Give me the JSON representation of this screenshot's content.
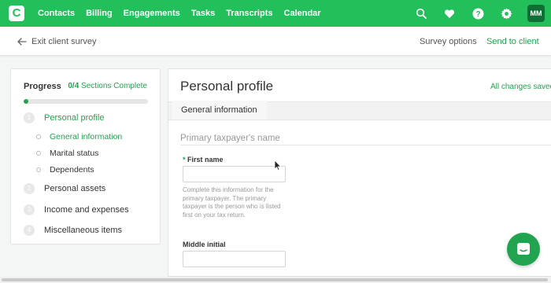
{
  "brand": {
    "logo_letter": "C",
    "accent": "#22bf5b"
  },
  "nav": {
    "items": [
      "Contacts",
      "Billing",
      "Engagements",
      "Tasks",
      "Transcripts",
      "Calendar"
    ],
    "icons": [
      "search-icon",
      "heart-icon",
      "help-icon",
      "gear-icon"
    ],
    "avatar": "MM"
  },
  "subheader": {
    "exit_label": "Exit client survey",
    "survey_options": "Survey options",
    "send_to_client": "Send to client"
  },
  "progress": {
    "title": "Progress",
    "count": "0/4",
    "count_suffix": " Sections Complete",
    "fraction": 0.02,
    "sections": [
      {
        "num": "1",
        "label": "Personal profile",
        "active": true,
        "subs": [
          "General information",
          "Marital status",
          "Dependents"
        ]
      },
      {
        "num": "2",
        "label": "Personal assets"
      },
      {
        "num": "3",
        "label": "Income and expenses"
      },
      {
        "num": "4",
        "label": "Miscellaneous items"
      }
    ]
  },
  "main": {
    "title": "Personal profile",
    "saved": "All changes saved",
    "section_tab": "General information",
    "group_title": "Primary taxpayer's name",
    "first_name_label": "First name",
    "required_mark": "*",
    "help_text": "Complete this information for the primary taxpayer. The primary taxpayer is the person who is listed first on your tax return.",
    "middle_initial_label": "Middle initial"
  }
}
